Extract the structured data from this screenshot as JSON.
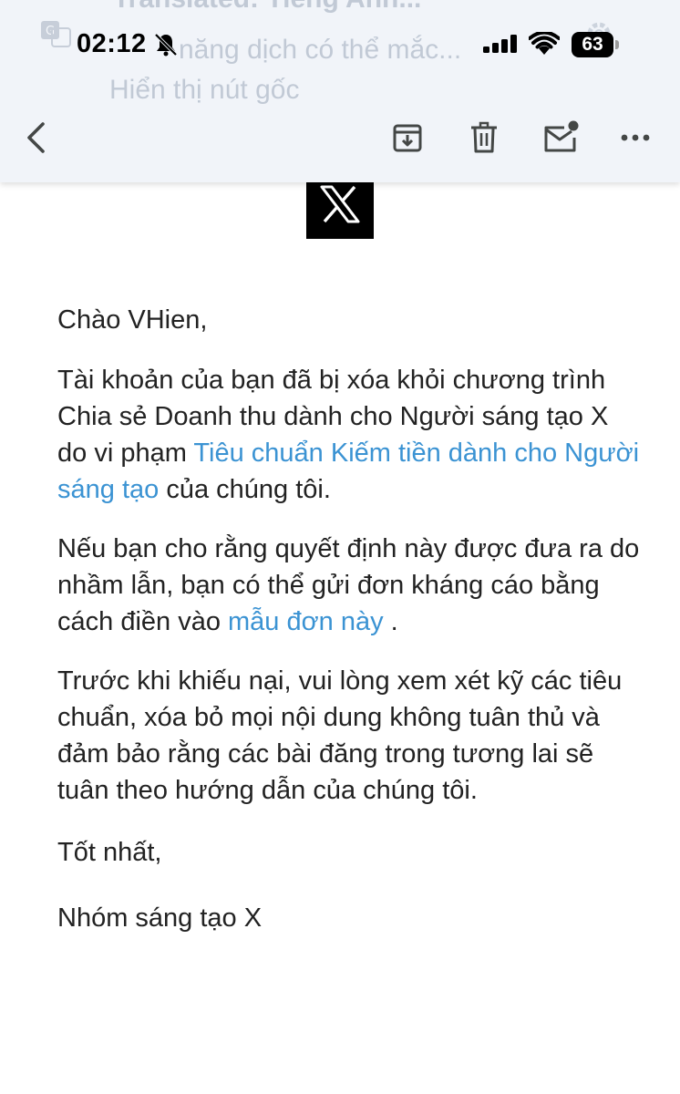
{
  "header": {
    "ghost_banner": {
      "line1": "Translated: Tiếng Anh...",
      "line2": "năng dịch có thể mắc...",
      "line3": "Hiển thị nút gốc"
    },
    "status_bar": {
      "time": "02:12",
      "battery": "63"
    },
    "toolbar": {
      "back_icon": "chevron-left-icon",
      "archive_icon": "archive-icon",
      "delete_icon": "trash-icon",
      "mark_unread_icon": "mail-unread-icon",
      "more_icon": "more-horizontal-icon"
    }
  },
  "email": {
    "logo_text": "X",
    "greeting": "Chào VHien,",
    "para1": {
      "before": "Tài khoản của bạn đã bị xóa khỏi chương trình Chia sẻ Doanh thu dành cho Người sáng tạo X do vi phạm ",
      "link": "Tiêu chuẩn Kiếm tiền dành cho Người sáng tạo",
      "after": " của chúng tôi."
    },
    "para2": {
      "before": "Nếu bạn cho rằng quyết định này được đưa ra do nhầm lẫn, bạn có thể gửi đơn kháng cáo bằng cách điền vào ",
      "link": "mẫu đơn này",
      "after": " ."
    },
    "para3": "Trước khi khiếu nại, vui lòng xem xét kỹ các tiêu chuẩn, xóa bỏ mọi nội dung không tuân thủ và đảm bảo rằng các bài đăng trong tương lai sẽ tuân theo hướng dẫn của chúng tôi.",
    "closing": "Tốt nhất,",
    "signature": "Nhóm sáng tạo X"
  },
  "colors": {
    "link": "#3b93d3",
    "header_bg": "#f1f4f9",
    "text": "#222222",
    "icon": "#444746"
  }
}
